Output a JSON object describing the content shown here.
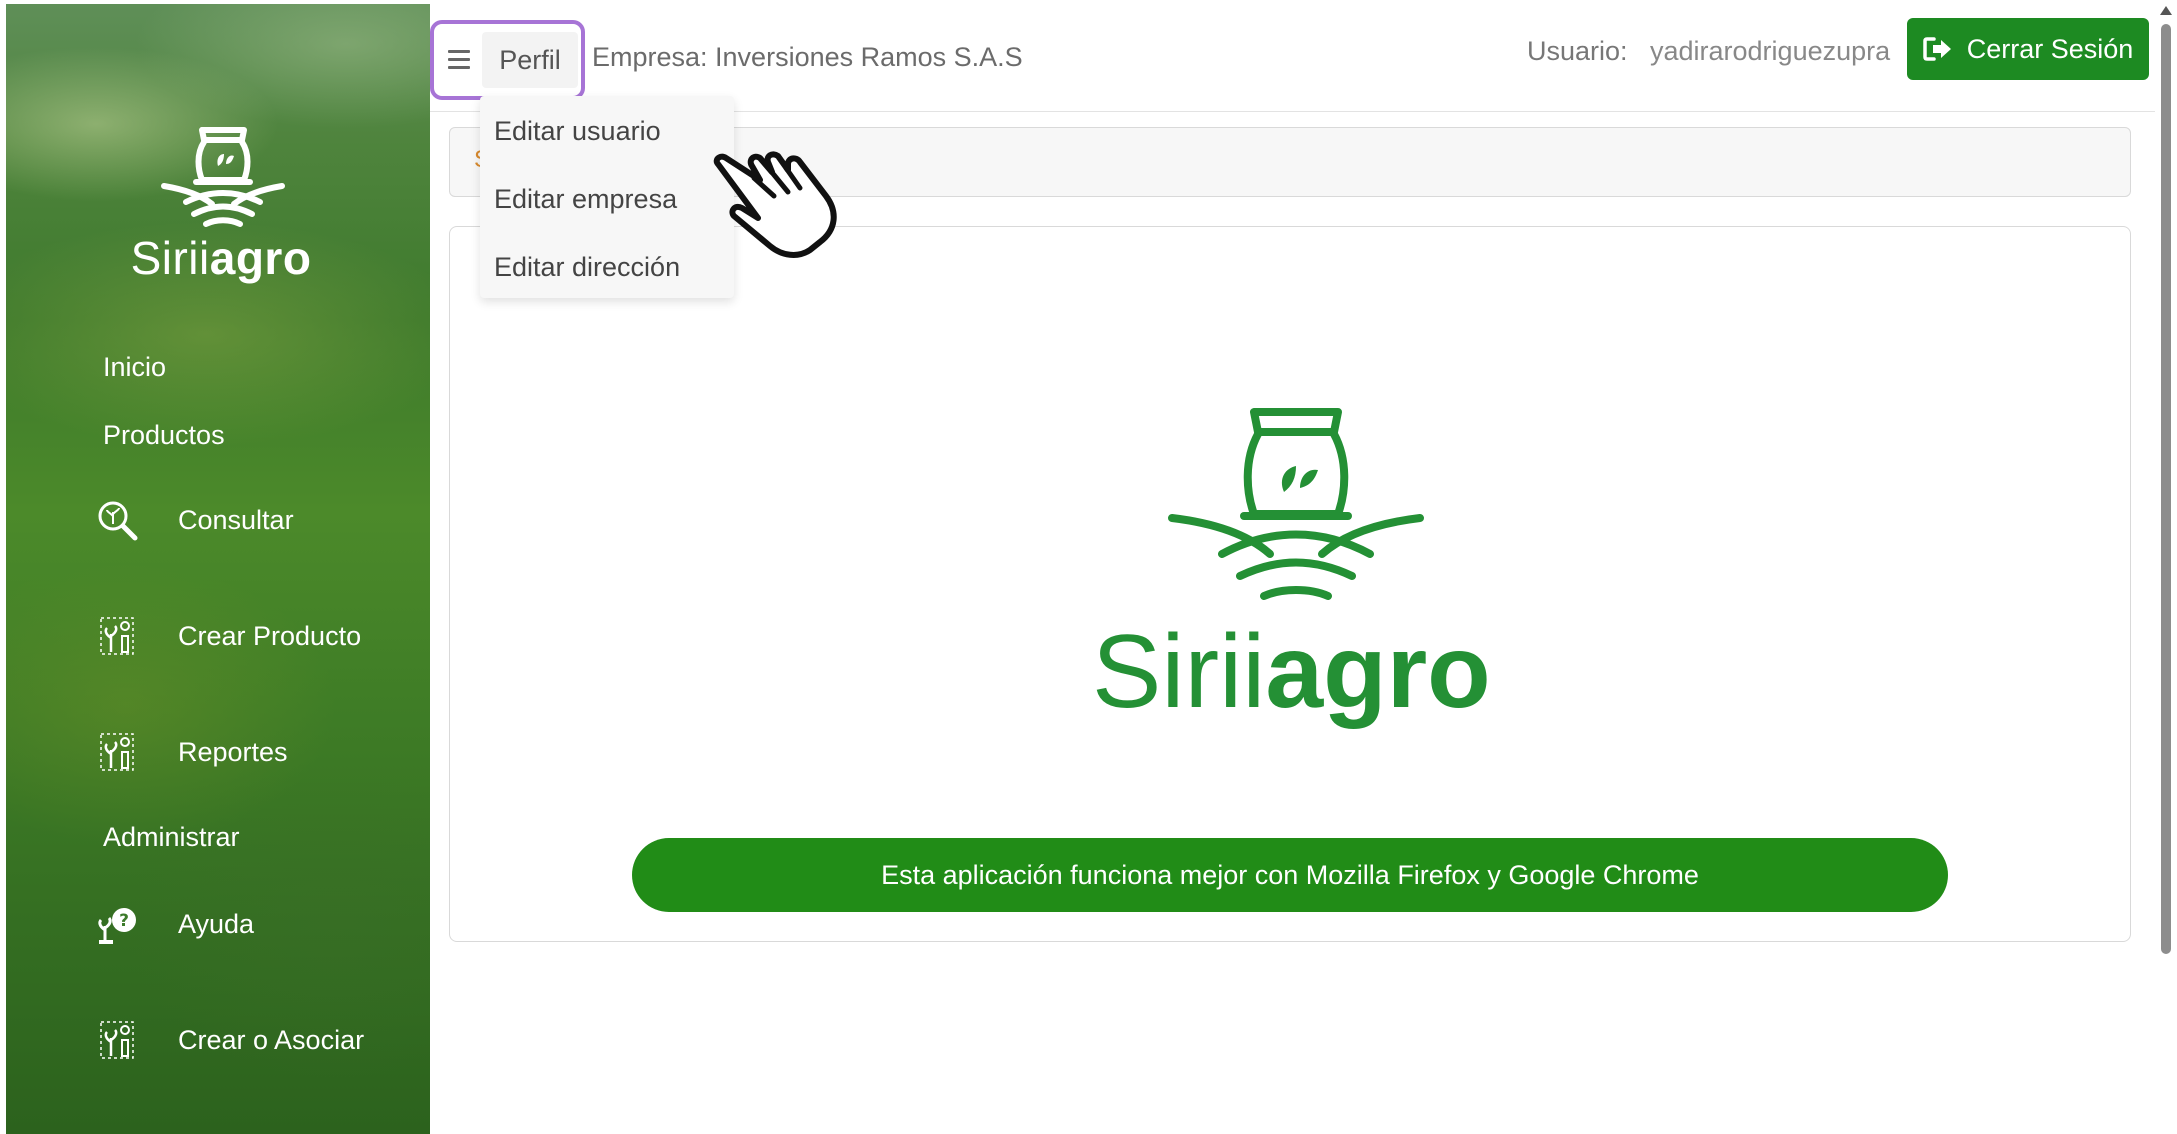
{
  "sidebar": {
    "brand": {
      "part1": "Sirii",
      "part2": "agro"
    },
    "sections": {
      "inicio": "Inicio",
      "productos": "Productos",
      "administrar": "Administrar"
    },
    "items": [
      {
        "label": "Consultar",
        "icon": "magnifier-leaf-icon"
      },
      {
        "label": "Crear Producto",
        "icon": "plant-product-icon"
      },
      {
        "label": "Reportes",
        "icon": "plant-report-icon"
      },
      {
        "label": "Ayuda",
        "icon": "plant-help-icon"
      },
      {
        "label": "Crear o Asociar",
        "icon": "plant-associate-icon"
      }
    ]
  },
  "header": {
    "perfil_label": "Perfil",
    "empresa": "Empresa: Inversiones Ramos S.A.S",
    "usuario_label": "Usuario:",
    "usuario_name": "yadirarodriguezupra",
    "logout_label": "Cerrar Sesión"
  },
  "dropdown": {
    "items": [
      "Editar usuario",
      "Editar empresa",
      "Editar dirección"
    ]
  },
  "main": {
    "breadcrumb_glimpse": "S",
    "brand": {
      "part1": "Sirii",
      "part2": "agro"
    },
    "banner": "Esta aplicación funciona mejor con Mozilla Firefox y Google Chrome"
  },
  "colors": {
    "brand_green": "#249035",
    "button_green": "#1d8a22",
    "banner_green": "#218c17",
    "highlight_purple": "#a774d6"
  }
}
